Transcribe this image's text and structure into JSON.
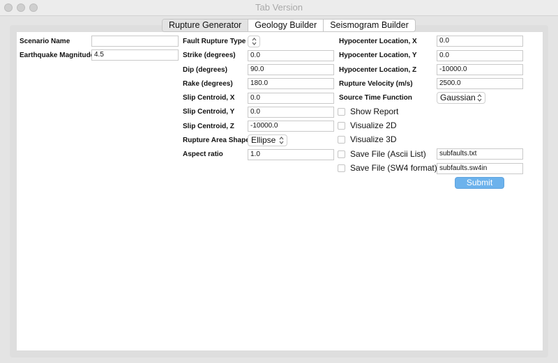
{
  "window": {
    "title": "Tab Version"
  },
  "tabs": [
    {
      "label": "Rupture Generator",
      "active": true
    },
    {
      "label": "Geology Builder",
      "active": false
    },
    {
      "label": "Seismogram Builder",
      "active": false
    }
  ],
  "col1": {
    "scenario_name": {
      "label": "Scenario Name",
      "value": ""
    },
    "magnitude": {
      "label": "Earthquake Magnitude",
      "value": "4.5"
    }
  },
  "col2": {
    "fault_type": {
      "label": "Fault Rupture Type",
      "value": ""
    },
    "strike": {
      "label": "Strike (degrees)",
      "value": "0.0"
    },
    "dip": {
      "label": "Dip (degrees)",
      "value": "90.0"
    },
    "rake": {
      "label": "Rake (degrees)",
      "value": "180.0"
    },
    "slip_x": {
      "label": "Slip Centroid, X",
      "value": "0.0"
    },
    "slip_y": {
      "label": "Slip Centroid, Y",
      "value": "0.0"
    },
    "slip_z": {
      "label": "Slip Centroid, Z",
      "value": "-10000.0"
    },
    "area_shape": {
      "label": "Rupture Area Shape",
      "value": "Ellipse"
    },
    "aspect": {
      "label": "Aspect ratio",
      "value": "1.0"
    }
  },
  "col3": {
    "hypo_x": {
      "label": "Hypocenter Location, X",
      "value": "0.0"
    },
    "hypo_y": {
      "label": "Hypocenter Location, Y",
      "value": "0.0"
    },
    "hypo_z": {
      "label": "Hypocenter Location, Z",
      "value": "-10000.0"
    },
    "velocity": {
      "label": "Rupture Velocity (m/s)",
      "value": "2500.0"
    },
    "stf": {
      "label": "Source Time Function",
      "value": "Gaussian"
    },
    "show_report": {
      "label": "Show Report",
      "checked": false
    },
    "visualize_2d": {
      "label": "Visualize 2D",
      "checked": false
    },
    "visualize_3d": {
      "label": "Visualize 3D",
      "checked": false
    },
    "save_ascii": {
      "label": "Save File (Ascii List)",
      "checked": false,
      "value": "subfaults.txt"
    },
    "save_sw4": {
      "label": "Save File (SW4 format)",
      "checked": false,
      "value": "subfaults.sw4in"
    },
    "submit_label": "Submit"
  },
  "colors": {
    "submit_bg": "#6cb2ec",
    "title_text": "#a9a9a9"
  },
  "icons": {
    "combo": "chevron-updown-icon",
    "window_controls": [
      "close-icon",
      "minimize-icon",
      "zoom-icon"
    ]
  }
}
